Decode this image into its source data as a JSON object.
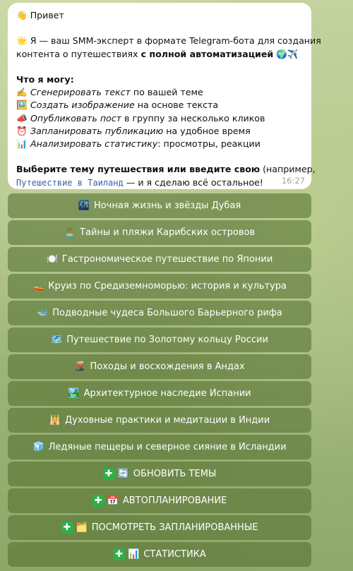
{
  "message": {
    "greeting_icon": "👋",
    "greeting": "Привет",
    "intro_icon": "🌟",
    "intro_line1": "Я — ваш SMM-эксперт в формате Telegram-бота для создания",
    "intro_line2_pre": "контента о путешествиях ",
    "intro_line2_bold": "с полной автоматизацией",
    "intro_line2_icons": " 🌍✈️",
    "abilities_title": "Что я могу:",
    "abilities": [
      {
        "icon": "✍️",
        "em": "Сгенерировать текст",
        "rest": " по вашей теме"
      },
      {
        "icon": "🖼️",
        "em": "Создать изображение",
        "rest": " на основе текста"
      },
      {
        "icon": "📣",
        "em": "Опубликовать пост",
        "rest": " в группу за несколько кликов"
      },
      {
        "icon": "⏰",
        "em": "Запланировать публикацию",
        "rest": " на удобное время"
      },
      {
        "icon": "📊",
        "em": "Анализировать статистику",
        "rest": ": просмотры, реакции"
      }
    ],
    "cta_bold": "Выберите тему путешествия или введите свою",
    "cta_rest": " (например,",
    "cta_example": "Путешествие в Таиланд",
    "cta_end": " — и я сделаю всё остальное!",
    "time": "16:27"
  },
  "keyboard": {
    "topics": [
      {
        "icon": "🌃",
        "label": "Ночная жизнь и звёзды Дубая"
      },
      {
        "icon": "🏝️",
        "label": "Тайны и пляжи Карибских островов"
      },
      {
        "icon": "🍽️",
        "label": "Гастрономическое путешествие по Японии"
      },
      {
        "icon": "🚤",
        "label": "Круиз по Средиземноморью: история и культура"
      },
      {
        "icon": "🐳",
        "label": "Подводные чудеса Большого Барьерного рифа"
      },
      {
        "icon": "🗺️",
        "label": "Путешествие по Золотому кольцу России"
      },
      {
        "icon": "🌋",
        "label": "Походы и восхождения в Андах"
      },
      {
        "icon": "🏞️",
        "label": "Архитектурное наследие Испании"
      },
      {
        "icon": "🕌",
        "label": "Духовные практики и медитации в Индии"
      },
      {
        "icon": "🧊",
        "label": "Ледяные пещеры и северное сияние в Исландии"
      }
    ],
    "actions": [
      {
        "plus": "✚",
        "icon": "🔄",
        "label": "ОБНОВИТЬ ТЕМЫ"
      },
      {
        "plus": "✚",
        "icon": "📅",
        "label": "АВТОПЛАНИРОВАНИЕ"
      },
      {
        "plus": "✚",
        "icon": "🗂️",
        "label": "ПОСМОТРЕТЬ ЗАПЛАНИРОВАННЫЕ"
      },
      {
        "plus": "✚",
        "icon": "📊",
        "label": "СТАТИСТИКА"
      }
    ]
  }
}
